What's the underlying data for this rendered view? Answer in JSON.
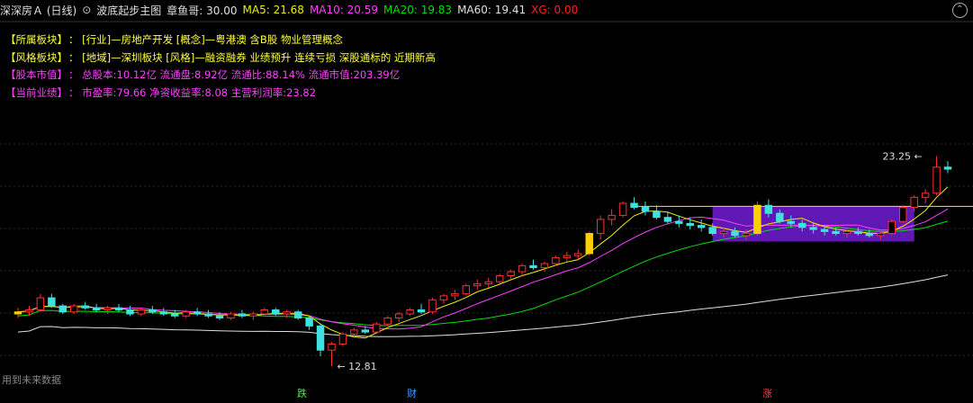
{
  "header": {
    "title": "深深房Ａ (日线)",
    "indicator": "波底起步主图",
    "zhang": {
      "label": "章鱼哥:",
      "value": "30.00"
    },
    "ma5": {
      "label": "MA5:",
      "value": "21.68",
      "color": "#f0f000"
    },
    "ma10": {
      "label": "MA10:",
      "value": "20.59",
      "color": "#ff40ff"
    },
    "ma20": {
      "label": "MA20:",
      "value": "19.83",
      "color": "#00e000"
    },
    "ma60": {
      "label": "MA60:",
      "value": "19.41",
      "color": "#e0e0e0"
    },
    "xg": {
      "label": "XG:",
      "value": "0.00",
      "color": "#ff2020"
    }
  },
  "info": [
    {
      "label": "【所属板块】",
      "sep": "：",
      "text": "[行业]—房地产开发 [概念]—粤港澳 含B股 物业管理概念",
      "color": "#ffff40"
    },
    {
      "label": "【风格板块】",
      "sep": "：",
      "text": "[地域]—深圳板块 [风格]—融资融券 业绩预升 连续亏损 深股通标的 近期新高",
      "color": "#ffff40"
    },
    {
      "label": "【股本市值】",
      "sep": "：",
      "text": "总股本:10.12亿 流通盘:8.92亿 流通比:88.14% 流通市值:203.39亿",
      "color": "#ff40ff"
    },
    {
      "label": "【当前业绩】",
      "sep": "：",
      "text": "市盈率:79.66 净资收益率:8.08 主营利润率:23.82",
      "color": "#ff40ff"
    }
  ],
  "annotations": {
    "high": "23.25",
    "low": "12.81",
    "future_note": "用到未来数据"
  },
  "bottom_marks": [
    {
      "text": "跌",
      "color": "#30ff30"
    },
    {
      "text": "财",
      "color": "#40a0ff"
    },
    {
      "text": "涨",
      "color": "#ff4040"
    }
  ],
  "chart_data": {
    "type": "candlestick",
    "ylim": [
      12.0,
      24.3
    ],
    "ohlc": [
      [
        15.4,
        15.7,
        15.2,
        15.5
      ],
      [
        15.5,
        15.8,
        15.3,
        15.6
      ],
      [
        15.6,
        16.4,
        15.5,
        16.2
      ],
      [
        16.2,
        16.4,
        15.7,
        15.8
      ],
      [
        15.8,
        15.9,
        15.4,
        15.5
      ],
      [
        15.5,
        15.9,
        15.4,
        15.8
      ],
      [
        15.8,
        16.0,
        15.6,
        15.7
      ],
      [
        15.7,
        15.9,
        15.5,
        15.6
      ],
      [
        15.6,
        15.8,
        15.4,
        15.7
      ],
      [
        15.7,
        15.9,
        15.5,
        15.6
      ],
      [
        15.6,
        15.8,
        15.3,
        15.4
      ],
      [
        15.4,
        15.7,
        15.3,
        15.6
      ],
      [
        15.6,
        15.8,
        15.4,
        15.5
      ],
      [
        15.5,
        15.7,
        15.3,
        15.4
      ],
      [
        15.4,
        15.6,
        15.2,
        15.3
      ],
      [
        15.3,
        15.6,
        15.2,
        15.5
      ],
      [
        15.5,
        15.7,
        15.3,
        15.4
      ],
      [
        15.4,
        15.6,
        15.2,
        15.3
      ],
      [
        15.3,
        15.5,
        15.1,
        15.2
      ],
      [
        15.2,
        15.5,
        15.1,
        15.4
      ],
      [
        15.4,
        15.6,
        15.2,
        15.3
      ],
      [
        15.3,
        15.5,
        15.1,
        15.4
      ],
      [
        15.4,
        15.7,
        15.3,
        15.6
      ],
      [
        15.6,
        15.7,
        15.3,
        15.4
      ],
      [
        15.4,
        15.6,
        15.2,
        15.5
      ],
      [
        15.5,
        15.6,
        15.1,
        15.2
      ],
      [
        15.2,
        15.3,
        14.6,
        14.8
      ],
      [
        14.8,
        14.9,
        13.3,
        13.6
      ],
      [
        13.6,
        14.0,
        12.81,
        13.9
      ],
      [
        13.9,
        14.5,
        13.8,
        14.4
      ],
      [
        14.4,
        14.7,
        14.2,
        14.6
      ],
      [
        14.6,
        14.8,
        14.4,
        14.5
      ],
      [
        14.5,
        15.0,
        14.4,
        14.9
      ],
      [
        14.9,
        15.3,
        14.8,
        15.2
      ],
      [
        15.2,
        15.5,
        15.0,
        15.4
      ],
      [
        15.4,
        15.7,
        15.3,
        15.6
      ],
      [
        15.6,
        15.9,
        15.4,
        15.5
      ],
      [
        15.5,
        16.2,
        15.4,
        16.1
      ],
      [
        16.1,
        16.4,
        15.9,
        16.3
      ],
      [
        16.3,
        16.6,
        16.1,
        16.4
      ],
      [
        16.4,
        16.9,
        16.3,
        16.8
      ],
      [
        16.8,
        17.1,
        16.6,
        16.9
      ],
      [
        16.9,
        17.2,
        16.7,
        17.0
      ],
      [
        17.0,
        17.4,
        16.9,
        17.3
      ],
      [
        17.3,
        17.6,
        17.1,
        17.5
      ],
      [
        17.5,
        17.9,
        17.3,
        17.8
      ],
      [
        17.8,
        18.1,
        17.6,
        17.7
      ],
      [
        17.7,
        18.0,
        17.5,
        17.9
      ],
      [
        17.9,
        18.3,
        17.8,
        18.2
      ],
      [
        18.2,
        18.5,
        18.0,
        18.3
      ],
      [
        18.3,
        18.6,
        18.1,
        18.4
      ],
      [
        18.4,
        19.5,
        18.3,
        19.4
      ],
      [
        19.4,
        20.3,
        19.1,
        20.1
      ],
      [
        20.1,
        20.6,
        19.8,
        20.3
      ],
      [
        20.3,
        21.0,
        20.2,
        20.9
      ],
      [
        20.9,
        21.2,
        20.6,
        20.7
      ],
      [
        20.7,
        21.0,
        20.3,
        20.5
      ],
      [
        20.5,
        20.8,
        20.1,
        20.2
      ],
      [
        20.2,
        20.5,
        19.9,
        20.0
      ],
      [
        20.0,
        20.3,
        19.7,
        19.9
      ],
      [
        19.9,
        20.2,
        19.6,
        19.8
      ],
      [
        19.8,
        20.1,
        19.5,
        19.7
      ],
      [
        19.7,
        19.9,
        19.3,
        19.4
      ],
      [
        19.4,
        19.7,
        19.2,
        19.5
      ],
      [
        19.5,
        19.7,
        19.2,
        19.3
      ],
      [
        19.3,
        19.6,
        19.1,
        19.4
      ],
      [
        19.4,
        21.0,
        19.3,
        20.8
      ],
      [
        20.8,
        21.1,
        20.2,
        20.4
      ],
      [
        20.4,
        20.6,
        19.9,
        20.0
      ],
      [
        20.0,
        20.3,
        19.7,
        19.9
      ],
      [
        19.9,
        20.1,
        19.5,
        19.7
      ],
      [
        19.7,
        19.9,
        19.4,
        19.6
      ],
      [
        19.6,
        19.8,
        19.3,
        19.5
      ],
      [
        19.5,
        19.7,
        19.3,
        19.4
      ],
      [
        19.4,
        19.6,
        19.2,
        19.5
      ],
      [
        19.5,
        19.7,
        19.3,
        19.4
      ],
      [
        19.4,
        19.6,
        19.2,
        19.3
      ],
      [
        19.3,
        19.5,
        19.1,
        19.4
      ],
      [
        19.4,
        20.1,
        19.3,
        20.0
      ],
      [
        20.0,
        20.8,
        19.9,
        20.7
      ],
      [
        20.7,
        21.3,
        20.5,
        21.2
      ],
      [
        21.2,
        21.6,
        20.9,
        21.4
      ],
      [
        21.4,
        23.25,
        21.3,
        22.7
      ],
      [
        22.7,
        23.0,
        22.4,
        22.6
      ]
    ]
  }
}
